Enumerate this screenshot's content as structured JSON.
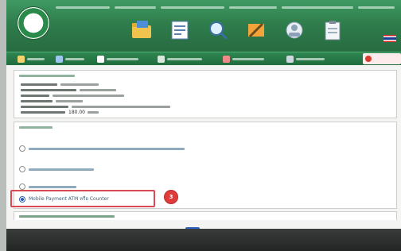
{
  "header": {
    "title": "",
    "tiles": [
      {
        "label": "",
        "icon": "folder-icon"
      },
      {
        "label": "",
        "icon": "document-icon"
      },
      {
        "label": "",
        "icon": "search-icon"
      },
      {
        "label": "",
        "icon": "tools-icon"
      },
      {
        "label": "",
        "icon": "contact-icon"
      },
      {
        "label": "",
        "icon": "clipboard-icon"
      }
    ]
  },
  "nav": {
    "items": [
      {
        "label": "",
        "icon": "home-icon"
      },
      {
        "label": "",
        "icon": "user-icon"
      },
      {
        "label": "",
        "icon": "document-icon"
      },
      {
        "label": "",
        "icon": "list-icon"
      },
      {
        "label": "",
        "icon": "chart-icon"
      },
      {
        "label": "",
        "icon": "settings-icon"
      }
    ],
    "logout_label": ""
  },
  "info": {
    "title": "",
    "rows": [
      {
        "value": ""
      },
      {
        "value": ""
      },
      {
        "value": ""
      },
      {
        "value": ""
      },
      {
        "value": ""
      },
      {
        "value": "180.00"
      }
    ]
  },
  "payment": {
    "title": "",
    "options": [
      {
        "label": "",
        "selected": false
      },
      {
        "label": "",
        "selected": false
      },
      {
        "label": "",
        "selected": false
      },
      {
        "label": "Mobile Payment ATM หรือ Counter",
        "selected": true
      }
    ],
    "step_badge": "3"
  },
  "rules": {
    "title": ""
  },
  "actions": {
    "ok_label": "",
    "cancel_label": ""
  },
  "footer": {
    "text": ""
  },
  "colors": {
    "header_green": "#2f7d4c",
    "highlight_red": "#d94a55",
    "badge_red": "#e03b3b",
    "ok_blue": "#2c63c2"
  }
}
